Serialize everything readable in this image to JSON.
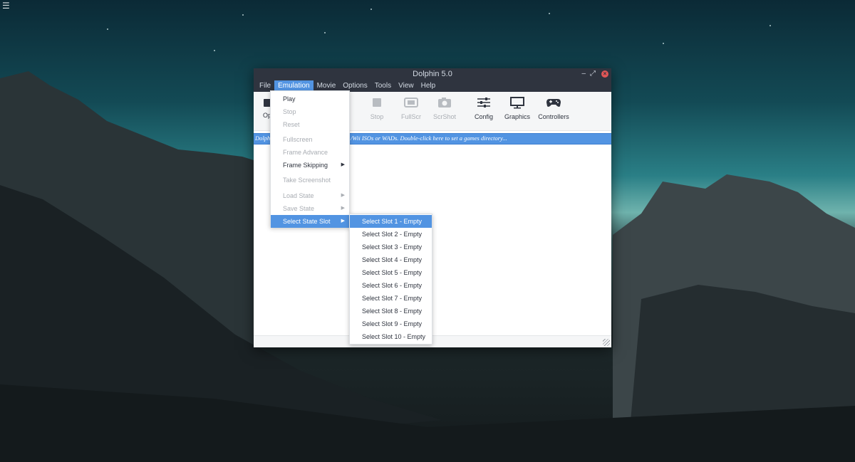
{
  "window": {
    "title": "Dolphin 5.0",
    "minimize": "–",
    "maximize": "⤢",
    "close": "×"
  },
  "menubar": [
    "File",
    "Emulation",
    "Movie",
    "Options",
    "Tools",
    "View",
    "Help"
  ],
  "active_menu": "Emulation",
  "toolbar": {
    "partial_label": "Op",
    "buttons": [
      {
        "label": "Stop",
        "icon": "stop-icon",
        "enabled": false
      },
      {
        "label": "FullScr",
        "icon": "fullscreen-icon",
        "enabled": false
      },
      {
        "label": "ScrShot",
        "icon": "camera-icon",
        "enabled": false
      },
      {
        "label": "Config",
        "icon": "sliders-icon",
        "enabled": true
      },
      {
        "label": "Graphics",
        "icon": "monitor-icon",
        "enabled": true
      },
      {
        "label": "Controllers",
        "icon": "gamepad-icon",
        "enabled": true
      }
    ]
  },
  "gamelist": {
    "text_left": "Dolph",
    "text_right": "/Wii ISOs or WADs. Double-click here to set a games directory..."
  },
  "emulation_menu": [
    {
      "label": "Play",
      "enabled": true
    },
    {
      "label": "Stop",
      "enabled": false
    },
    {
      "label": "Reset",
      "enabled": false
    },
    {
      "label": "Fullscreen",
      "enabled": false
    },
    {
      "label": "Frame Advance",
      "enabled": false
    },
    {
      "label": "Frame Skipping",
      "enabled": true,
      "submenu": true
    },
    {
      "label": "Take Screenshot",
      "enabled": false
    },
    {
      "label": "Load State",
      "enabled": false,
      "submenu": true
    },
    {
      "label": "Save State",
      "enabled": false,
      "submenu": true
    },
    {
      "label": "Select State Slot",
      "enabled": true,
      "submenu": true,
      "highlighted": true
    }
  ],
  "state_slot_menu": [
    "Select Slot 1 - Empty",
    "Select Slot 2 - Empty",
    "Select Slot 3 - Empty",
    "Select Slot 4 - Empty",
    "Select Slot 5 - Empty",
    "Select Slot 6 - Empty",
    "Select Slot 7 - Empty",
    "Select Slot 8 - Empty",
    "Select Slot 9 - Empty",
    "Select Slot 10 - Empty"
  ],
  "colors": {
    "accent": "#5294e2",
    "titlebar": "#2f343f",
    "close": "#e05656"
  }
}
